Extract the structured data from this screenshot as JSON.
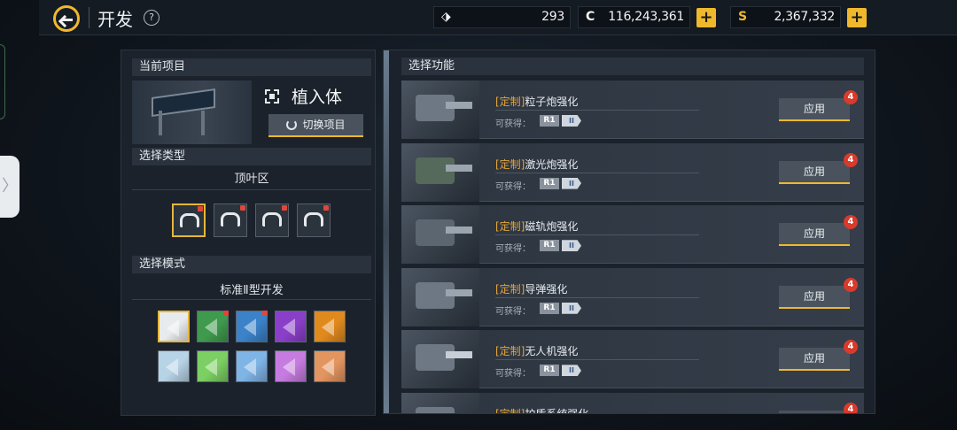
{
  "header": {
    "title": "开发",
    "help": "?",
    "resources": {
      "parts": {
        "icon": "parts-icon",
        "value": "293"
      },
      "credits": {
        "icon": "C",
        "value": "116,243,361"
      },
      "silver": {
        "icon": "S",
        "value": "2,367,332"
      },
      "plus": "+"
    }
  },
  "side": {
    "handle": "〉"
  },
  "left": {
    "current_project": {
      "heading": "当前项目",
      "name": "植入体",
      "switch_label": "切换项目"
    },
    "type": {
      "heading": "选择类型",
      "sub": "顶叶区",
      "slots": [
        {
          "name": "type-slot-1",
          "selected": true,
          "dot": true
        },
        {
          "name": "type-slot-2",
          "selected": false,
          "dot": true
        },
        {
          "name": "type-slot-3",
          "selected": false,
          "dot": true
        },
        {
          "name": "type-slot-4",
          "selected": false,
          "dot": true
        }
      ]
    },
    "mode": {
      "heading": "选择模式",
      "sub": "标准Ⅱ型开发",
      "colors": [
        "#e8ebee",
        "#3f9a4d",
        "#3b82c9",
        "#8a3fc8",
        "#e08a1e",
        "#b7d3e6",
        "#7ccf62",
        "#7fb4e6",
        "#c67be0",
        "#e39560"
      ],
      "selected_index": 0,
      "dots": [
        1,
        2
      ]
    }
  },
  "right": {
    "heading": "选择功能",
    "gain_label": "可获得：",
    "r1": "R1",
    "lvl": "II",
    "apply_label": "应用",
    "tag": "[定制]",
    "items": [
      {
        "name": "粒子炮强化",
        "badge": "4"
      },
      {
        "name": "激光炮强化",
        "badge": "4"
      },
      {
        "name": "磁轨炮强化",
        "badge": "4"
      },
      {
        "name": "导弹强化",
        "badge": "4"
      },
      {
        "name": "无人机强化",
        "badge": "4"
      },
      {
        "name": "护盾系统强化",
        "badge": "4"
      }
    ]
  }
}
